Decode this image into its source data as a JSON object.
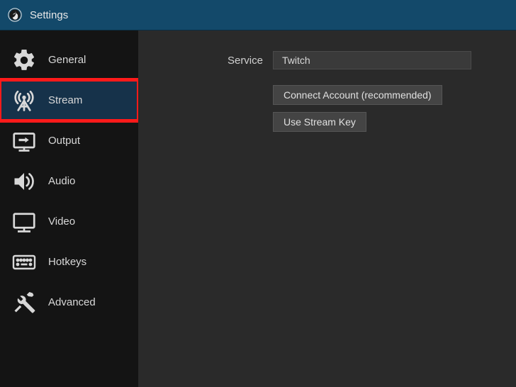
{
  "window": {
    "title": "Settings"
  },
  "sidebar": {
    "items": [
      {
        "label": "General"
      },
      {
        "label": "Stream"
      },
      {
        "label": "Output"
      },
      {
        "label": "Audio"
      },
      {
        "label": "Video"
      },
      {
        "label": "Hotkeys"
      },
      {
        "label": "Advanced"
      }
    ]
  },
  "stream": {
    "service_label": "Service",
    "service_value": "Twitch",
    "connect_button": "Connect Account (recommended)",
    "streamkey_button": "Use Stream Key"
  }
}
